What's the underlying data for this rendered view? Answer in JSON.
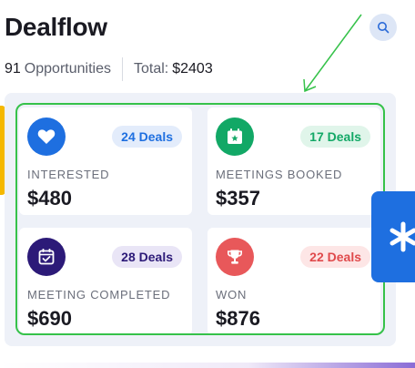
{
  "header": {
    "title": "Dealflow",
    "opportunities_count": "91",
    "opportunities_label": "Opportunities",
    "total_label": "Total:",
    "total_value": "$2403",
    "search_icon": "search-icon"
  },
  "cards": [
    {
      "label": "INTERESTED",
      "value": "$480",
      "badge": "24 Deals",
      "icon": "heart-icon",
      "icon_bg": "#1e6fe0",
      "badge_bg": "#e3ecfb",
      "badge_color": "#1e6fe0"
    },
    {
      "label": "MEETINGS BOOKED",
      "value": "$357",
      "badge": "17 Deals",
      "icon": "calendar-star-icon",
      "icon_bg": "#12a866",
      "badge_bg": "#e0f5ea",
      "badge_color": "#12a866"
    },
    {
      "label": "MEETING COMPLETED",
      "value": "$690",
      "badge": "28 Deals",
      "icon": "calendar-check-icon",
      "icon_bg": "#2c1a78",
      "badge_bg": "#e9e5f6",
      "badge_color": "#2c1a78"
    },
    {
      "label": "WON",
      "value": "$876",
      "badge": "22 Deals",
      "icon": "trophy-icon",
      "icon_bg": "#e8585a",
      "badge_bg": "#fde6e6",
      "badge_color": "#e04a4c"
    }
  ],
  "colors": {
    "highlight": "#36c24a",
    "panel_bg": "#eef1f8",
    "left_tab": "#f5b800",
    "right_tab": "#1e6fe0"
  }
}
